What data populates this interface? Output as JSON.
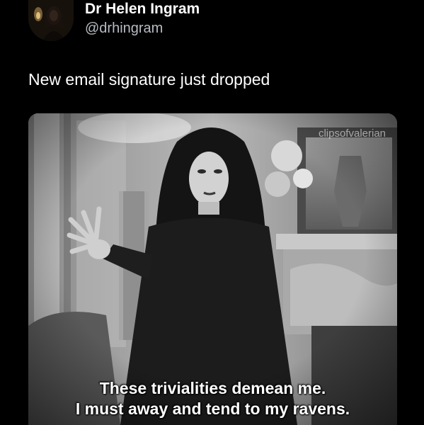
{
  "post": {
    "author": {
      "display_name": "Dr Helen Ingram",
      "handle": "@drhingram"
    },
    "text": "New email signature just dropped",
    "media": {
      "watermark": "clipsofvalerian",
      "caption": [
        "These trivialities demean me.",
        "I must away and tend to my ravens."
      ]
    }
  },
  "colors": {
    "background": "#000000",
    "name_text": "#ffffff",
    "handle_text": "#b7bcc2"
  }
}
